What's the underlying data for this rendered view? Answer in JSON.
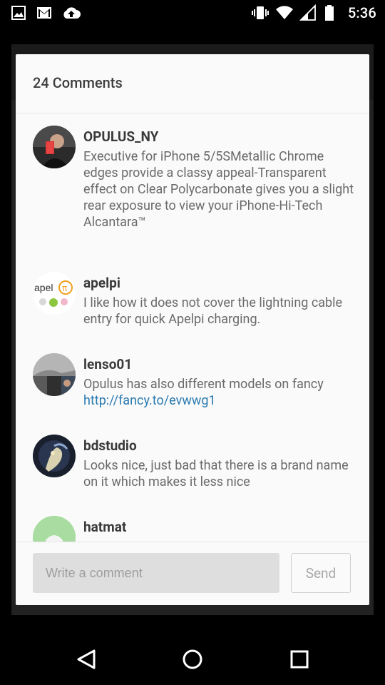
{
  "status_bar": {
    "time": "5:36",
    "left_icons": [
      "image-icon",
      "gmail-icon",
      "cloud-upload-icon"
    ],
    "right_icons": [
      "vibrate-icon",
      "wifi-icon",
      "signal-icon",
      "battery-icon"
    ]
  },
  "dialog": {
    "title": "24 Comments",
    "comments": [
      {
        "author": "OPULUS_NY",
        "text": "Executive for iPhone 5/5SMetallic Chrome edges provide a classy appeal-Transparent effect on Clear Polycarbonate gives you a slight rear exposure to view your iPhone-Hi-Tech Alcantara™",
        "avatar": "photo-avatar"
      },
      {
        "author": "apelpi",
        "text": "I like how it does not cover the lightning cable entry for quick Apelpi charging.",
        "avatar": "apelpi-logo-avatar",
        "avatar_text": "apel"
      },
      {
        "author": "lenso01",
        "text": "Opulus has also different models on fancy",
        "link": "http://fancy.to/evwwg1",
        "avatar": "collage-avatar"
      },
      {
        "author": "bdstudio",
        "text": "Looks nice, just bad that there is a brand name on it which makes it less nice",
        "avatar": "artwork-avatar"
      },
      {
        "author": "hatmat",
        "text": "",
        "avatar": "green-avatar"
      }
    ],
    "input_placeholder": "Write a comment",
    "send_label": "Send"
  },
  "nav_bar": {
    "buttons": [
      "back-icon",
      "home-icon",
      "recents-icon"
    ]
  },
  "colors": {
    "dialog_bg": "#fafafa",
    "link": "#2a7ab0",
    "name": "#3a3a3a",
    "text": "#6a6a6a"
  }
}
